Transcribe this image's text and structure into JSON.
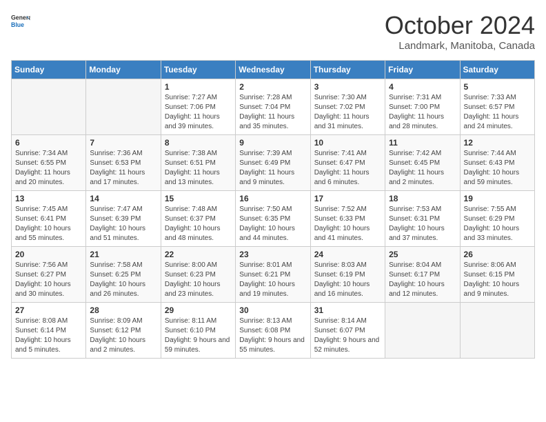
{
  "header": {
    "logo_general": "General",
    "logo_blue": "Blue",
    "month_title": "October 2024",
    "subtitle": "Landmark, Manitoba, Canada"
  },
  "days_of_week": [
    "Sunday",
    "Monday",
    "Tuesday",
    "Wednesday",
    "Thursday",
    "Friday",
    "Saturday"
  ],
  "weeks": [
    [
      {
        "num": "",
        "sunrise": "",
        "sunset": "",
        "daylight": "",
        "empty": true
      },
      {
        "num": "",
        "sunrise": "",
        "sunset": "",
        "daylight": "",
        "empty": true
      },
      {
        "num": "1",
        "sunrise": "Sunrise: 7:27 AM",
        "sunset": "Sunset: 7:06 PM",
        "daylight": "Daylight: 11 hours and 39 minutes.",
        "empty": false
      },
      {
        "num": "2",
        "sunrise": "Sunrise: 7:28 AM",
        "sunset": "Sunset: 7:04 PM",
        "daylight": "Daylight: 11 hours and 35 minutes.",
        "empty": false
      },
      {
        "num": "3",
        "sunrise": "Sunrise: 7:30 AM",
        "sunset": "Sunset: 7:02 PM",
        "daylight": "Daylight: 11 hours and 31 minutes.",
        "empty": false
      },
      {
        "num": "4",
        "sunrise": "Sunrise: 7:31 AM",
        "sunset": "Sunset: 7:00 PM",
        "daylight": "Daylight: 11 hours and 28 minutes.",
        "empty": false
      },
      {
        "num": "5",
        "sunrise": "Sunrise: 7:33 AM",
        "sunset": "Sunset: 6:57 PM",
        "daylight": "Daylight: 11 hours and 24 minutes.",
        "empty": false
      }
    ],
    [
      {
        "num": "6",
        "sunrise": "Sunrise: 7:34 AM",
        "sunset": "Sunset: 6:55 PM",
        "daylight": "Daylight: 11 hours and 20 minutes.",
        "empty": false
      },
      {
        "num": "7",
        "sunrise": "Sunrise: 7:36 AM",
        "sunset": "Sunset: 6:53 PM",
        "daylight": "Daylight: 11 hours and 17 minutes.",
        "empty": false
      },
      {
        "num": "8",
        "sunrise": "Sunrise: 7:38 AM",
        "sunset": "Sunset: 6:51 PM",
        "daylight": "Daylight: 11 hours and 13 minutes.",
        "empty": false
      },
      {
        "num": "9",
        "sunrise": "Sunrise: 7:39 AM",
        "sunset": "Sunset: 6:49 PM",
        "daylight": "Daylight: 11 hours and 9 minutes.",
        "empty": false
      },
      {
        "num": "10",
        "sunrise": "Sunrise: 7:41 AM",
        "sunset": "Sunset: 6:47 PM",
        "daylight": "Daylight: 11 hours and 6 minutes.",
        "empty": false
      },
      {
        "num": "11",
        "sunrise": "Sunrise: 7:42 AM",
        "sunset": "Sunset: 6:45 PM",
        "daylight": "Daylight: 11 hours and 2 minutes.",
        "empty": false
      },
      {
        "num": "12",
        "sunrise": "Sunrise: 7:44 AM",
        "sunset": "Sunset: 6:43 PM",
        "daylight": "Daylight: 10 hours and 59 minutes.",
        "empty": false
      }
    ],
    [
      {
        "num": "13",
        "sunrise": "Sunrise: 7:45 AM",
        "sunset": "Sunset: 6:41 PM",
        "daylight": "Daylight: 10 hours and 55 minutes.",
        "empty": false
      },
      {
        "num": "14",
        "sunrise": "Sunrise: 7:47 AM",
        "sunset": "Sunset: 6:39 PM",
        "daylight": "Daylight: 10 hours and 51 minutes.",
        "empty": false
      },
      {
        "num": "15",
        "sunrise": "Sunrise: 7:48 AM",
        "sunset": "Sunset: 6:37 PM",
        "daylight": "Daylight: 10 hours and 48 minutes.",
        "empty": false
      },
      {
        "num": "16",
        "sunrise": "Sunrise: 7:50 AM",
        "sunset": "Sunset: 6:35 PM",
        "daylight": "Daylight: 10 hours and 44 minutes.",
        "empty": false
      },
      {
        "num": "17",
        "sunrise": "Sunrise: 7:52 AM",
        "sunset": "Sunset: 6:33 PM",
        "daylight": "Daylight: 10 hours and 41 minutes.",
        "empty": false
      },
      {
        "num": "18",
        "sunrise": "Sunrise: 7:53 AM",
        "sunset": "Sunset: 6:31 PM",
        "daylight": "Daylight: 10 hours and 37 minutes.",
        "empty": false
      },
      {
        "num": "19",
        "sunrise": "Sunrise: 7:55 AM",
        "sunset": "Sunset: 6:29 PM",
        "daylight": "Daylight: 10 hours and 33 minutes.",
        "empty": false
      }
    ],
    [
      {
        "num": "20",
        "sunrise": "Sunrise: 7:56 AM",
        "sunset": "Sunset: 6:27 PM",
        "daylight": "Daylight: 10 hours and 30 minutes.",
        "empty": false
      },
      {
        "num": "21",
        "sunrise": "Sunrise: 7:58 AM",
        "sunset": "Sunset: 6:25 PM",
        "daylight": "Daylight: 10 hours and 26 minutes.",
        "empty": false
      },
      {
        "num": "22",
        "sunrise": "Sunrise: 8:00 AM",
        "sunset": "Sunset: 6:23 PM",
        "daylight": "Daylight: 10 hours and 23 minutes.",
        "empty": false
      },
      {
        "num": "23",
        "sunrise": "Sunrise: 8:01 AM",
        "sunset": "Sunset: 6:21 PM",
        "daylight": "Daylight: 10 hours and 19 minutes.",
        "empty": false
      },
      {
        "num": "24",
        "sunrise": "Sunrise: 8:03 AM",
        "sunset": "Sunset: 6:19 PM",
        "daylight": "Daylight: 10 hours and 16 minutes.",
        "empty": false
      },
      {
        "num": "25",
        "sunrise": "Sunrise: 8:04 AM",
        "sunset": "Sunset: 6:17 PM",
        "daylight": "Daylight: 10 hours and 12 minutes.",
        "empty": false
      },
      {
        "num": "26",
        "sunrise": "Sunrise: 8:06 AM",
        "sunset": "Sunset: 6:15 PM",
        "daylight": "Daylight: 10 hours and 9 minutes.",
        "empty": false
      }
    ],
    [
      {
        "num": "27",
        "sunrise": "Sunrise: 8:08 AM",
        "sunset": "Sunset: 6:14 PM",
        "daylight": "Daylight: 10 hours and 5 minutes.",
        "empty": false
      },
      {
        "num": "28",
        "sunrise": "Sunrise: 8:09 AM",
        "sunset": "Sunset: 6:12 PM",
        "daylight": "Daylight: 10 hours and 2 minutes.",
        "empty": false
      },
      {
        "num": "29",
        "sunrise": "Sunrise: 8:11 AM",
        "sunset": "Sunset: 6:10 PM",
        "daylight": "Daylight: 9 hours and 59 minutes.",
        "empty": false
      },
      {
        "num": "30",
        "sunrise": "Sunrise: 8:13 AM",
        "sunset": "Sunset: 6:08 PM",
        "daylight": "Daylight: 9 hours and 55 minutes.",
        "empty": false
      },
      {
        "num": "31",
        "sunrise": "Sunrise: 8:14 AM",
        "sunset": "Sunset: 6:07 PM",
        "daylight": "Daylight: 9 hours and 52 minutes.",
        "empty": false
      },
      {
        "num": "",
        "sunrise": "",
        "sunset": "",
        "daylight": "",
        "empty": true
      },
      {
        "num": "",
        "sunrise": "",
        "sunset": "",
        "daylight": "",
        "empty": true
      }
    ]
  ]
}
